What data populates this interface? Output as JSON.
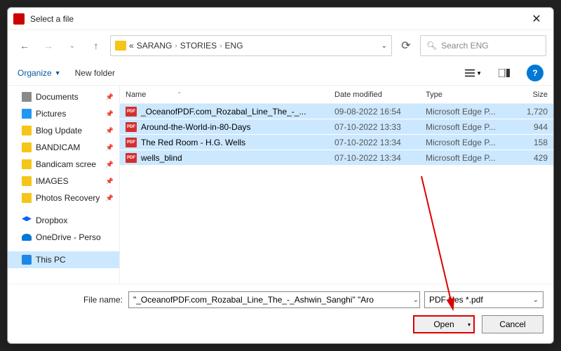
{
  "title": "Select a file",
  "path": {
    "prefix": "«",
    "parts": [
      "SARANG",
      "STORIES",
      "ENG"
    ]
  },
  "search": {
    "placeholder": "Search ENG"
  },
  "toolbar": {
    "organize": "Organize",
    "newfolder": "New folder"
  },
  "sidebar": [
    {
      "label": "Documents",
      "icon": "docs",
      "pinned": true
    },
    {
      "label": "Pictures",
      "icon": "pictures",
      "pinned": true
    },
    {
      "label": "Blog Update",
      "icon": "folder",
      "pinned": true
    },
    {
      "label": "BANDICAM",
      "icon": "folder",
      "pinned": true
    },
    {
      "label": "Bandicam scree",
      "icon": "folder",
      "pinned": true
    },
    {
      "label": "IMAGES",
      "icon": "folder",
      "pinned": true
    },
    {
      "label": "Photos Recovery",
      "icon": "folder",
      "pinned": true
    },
    {
      "label": "",
      "icon": "",
      "blank": true
    },
    {
      "label": "Dropbox",
      "icon": "dropbox"
    },
    {
      "label": "OneDrive - Perso",
      "icon": "onedrive"
    },
    {
      "label": "",
      "icon": "",
      "blank": true
    },
    {
      "label": "This PC",
      "icon": "thispc",
      "active": true
    }
  ],
  "columns": {
    "name": "Name",
    "date": "Date modified",
    "type": "Type",
    "size": "Size"
  },
  "files": [
    {
      "name": "_OceanofPDF.com_Rozabal_Line_The_-_...",
      "date": "09-08-2022 16:54",
      "type": "Microsoft Edge P...",
      "size": "1,720"
    },
    {
      "name": "Around-the-World-in-80-Days",
      "date": "07-10-2022 13:33",
      "type": "Microsoft Edge P...",
      "size": "944"
    },
    {
      "name": "The Red Room - H.G. Wells",
      "date": "07-10-2022 13:34",
      "type": "Microsoft Edge P...",
      "size": "158"
    },
    {
      "name": "wells_blind",
      "date": "07-10-2022 13:34",
      "type": "Microsoft Edge P...",
      "size": "429"
    }
  ],
  "footer": {
    "filename_label": "File name:",
    "filename_value": "\"_OceanofPDF.com_Rozabal_Line_The_-_Ashwin_Sanghi\" \"Aro",
    "filter": "PDF files *.pdf",
    "open": "Open",
    "cancel": "Cancel"
  }
}
